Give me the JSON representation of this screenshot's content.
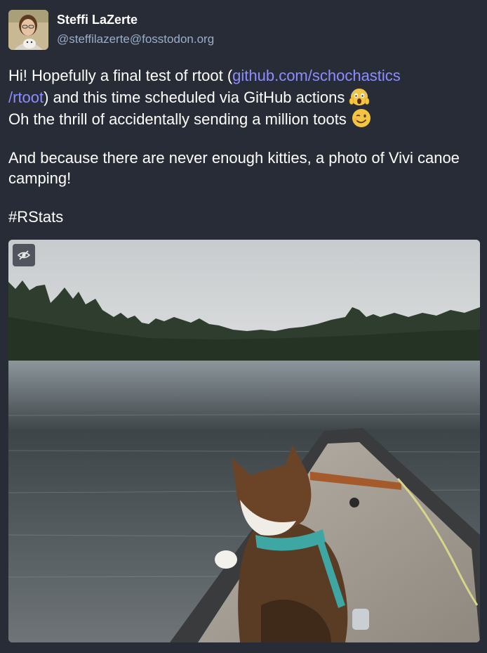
{
  "account": {
    "display_name": "Steffi LaZerte",
    "handle": "@steffilazerte@fosstodon.org"
  },
  "status": {
    "p1_line1_text": "Hi! Hopefully a final test of rtoot (",
    "p1_link_part1": "github.com/schochastics",
    "p1_link_part2": "/rtoot",
    "p1_line2_text": ") and this time scheduled via GitHub actions",
    "p1_line3_text": "Oh the thrill of accidentally sending a million toots",
    "p2_text": "And because there are never enough kitties, a photo of Vivi canoe camping!",
    "hashtag": "#RStats"
  },
  "icons": {
    "emoji_1": "screaming-face-emoji",
    "emoji_2": "winking-face-emoji",
    "hide_media": "eye-slash-icon"
  },
  "colors": {
    "background": "#282c37",
    "link": "#8c8dff",
    "handle": "#9baec8",
    "text": "#ffffff"
  }
}
